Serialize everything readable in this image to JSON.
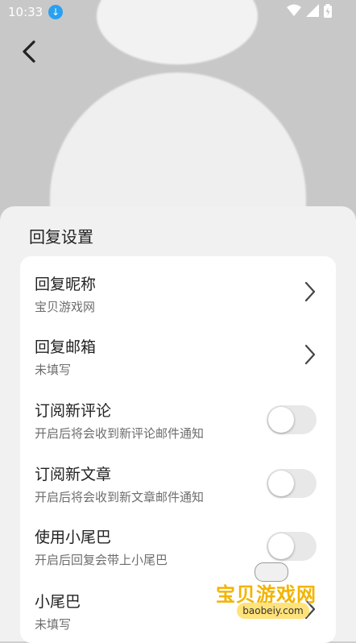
{
  "status_bar": {
    "time": "10:33",
    "icons": [
      "download-icon",
      "wifi-icon",
      "signal-icon",
      "battery-icon"
    ]
  },
  "header": {
    "back_icon": "chevron-left-icon"
  },
  "sheet": {
    "title": "回复设置",
    "rows": [
      {
        "title": "回复昵称",
        "subtitle": "宝贝游戏网",
        "control": "chevron"
      },
      {
        "title": "回复邮箱",
        "subtitle": "未填写",
        "control": "chevron"
      },
      {
        "title": "订阅新评论",
        "subtitle": "开启后将会收到新评论邮件通知",
        "control": "toggle",
        "on": false
      },
      {
        "title": "订阅新文章",
        "subtitle": "开启后将会收到新文章邮件通知",
        "control": "toggle",
        "on": false
      },
      {
        "title": "使用小尾巴",
        "subtitle": "开启后回复会带上小尾巴",
        "control": "toggle",
        "on": false
      },
      {
        "title": "小尾巴",
        "subtitle": "未填写",
        "control": "chevron"
      }
    ]
  },
  "watermark": {
    "text": "宝贝游戏网",
    "url": "baobeiy.com"
  },
  "colors": {
    "accent_download": "#2aa0f0",
    "watermark": "#f2b400"
  }
}
